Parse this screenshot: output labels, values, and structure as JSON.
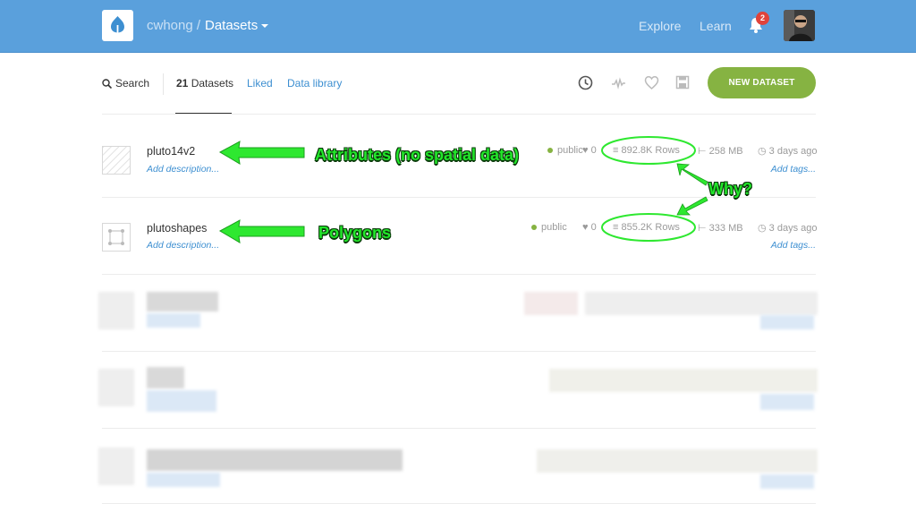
{
  "topbar": {
    "user": "cwhong",
    "separator": "/",
    "page": "Datasets",
    "nav": [
      "Explore",
      "Learn"
    ],
    "notification_count": "2"
  },
  "filters": {
    "search_label": "Search",
    "count": "21",
    "count_label": "Datasets",
    "liked": "Liked",
    "library": "Data library",
    "new_dataset": "NEW DATASET"
  },
  "datasets": [
    {
      "name": "pluto14v2",
      "description": "Add description...",
      "privacy": "public",
      "likes": "0",
      "rows": "892.8K Rows",
      "size": "258 MB",
      "updated": "3 days ago",
      "tags": "Add tags..."
    },
    {
      "name": "plutoshapes",
      "description": "Add description...",
      "privacy": "public",
      "likes": "0",
      "rows": "855.2K Rows",
      "size": "333 MB",
      "updated": "3 days ago",
      "tags": "Add tags..."
    }
  ],
  "annotations": {
    "row1": "Attributes (no spatial data)",
    "row2": "Polygons",
    "question": "Why?"
  },
  "colors": {
    "topbar": "#5aa0dc",
    "accent_link": "#3d8fd1",
    "new_button": "#86b342",
    "annotation": "#22e62a"
  }
}
